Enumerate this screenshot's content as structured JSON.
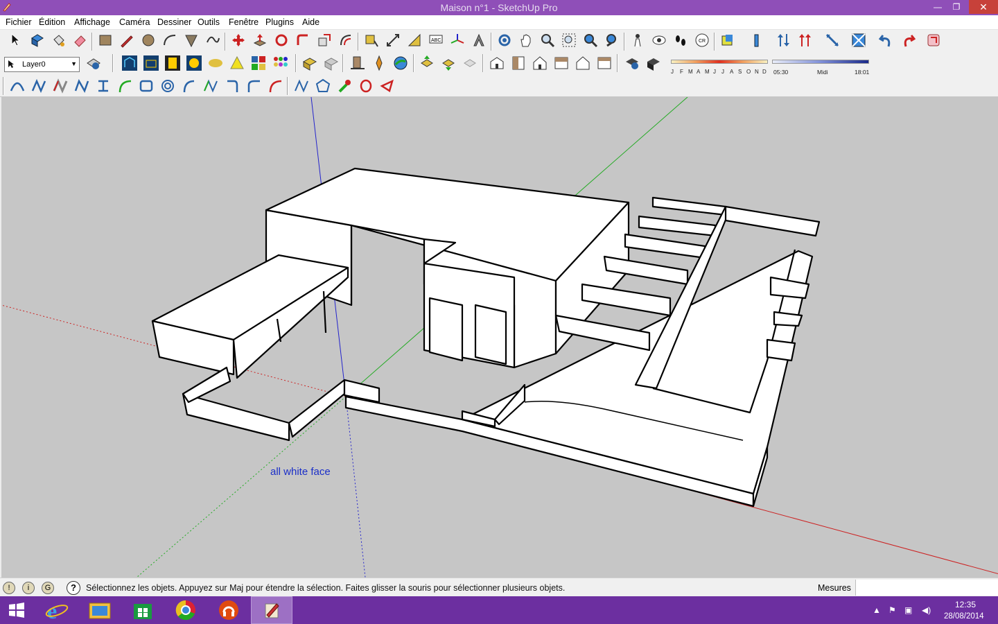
{
  "window": {
    "title": "Maison n°1 - SketchUp Pro",
    "minimize": "—",
    "maximize": "❐",
    "close": "✕"
  },
  "menu": [
    "Fichier",
    "Édition",
    "Affichage",
    "Caméra",
    "Dessiner",
    "Outils",
    "Fenêtre",
    "Plugins",
    "Aide"
  ],
  "layers": {
    "current": "Layer0"
  },
  "shadow": {
    "months": [
      "J",
      "F",
      "M",
      "A",
      "M",
      "J",
      "J",
      "A",
      "S",
      "O",
      "N",
      "D"
    ],
    "time_start": "05:30",
    "time_mid": "Midi",
    "time_end": "18:01"
  },
  "viewport": {
    "annotation": "all white face",
    "background": "#c6c6c6"
  },
  "status": {
    "message": "Sélectionnez les objets. Appuyez sur Maj pour étendre la sélection. Faites glisser la souris pour sélectionner plusieurs objets.",
    "measures_label": "Mesures",
    "measures_value": ""
  },
  "taskbar": {
    "time": "12:35",
    "date": "28/08/2014"
  },
  "colors": {
    "titlebar": "#8f4fb8",
    "taskbar": "#6c2fa0",
    "axis_red": "#c22",
    "axis_green": "#2a2",
    "axis_blue": "#22c"
  }
}
